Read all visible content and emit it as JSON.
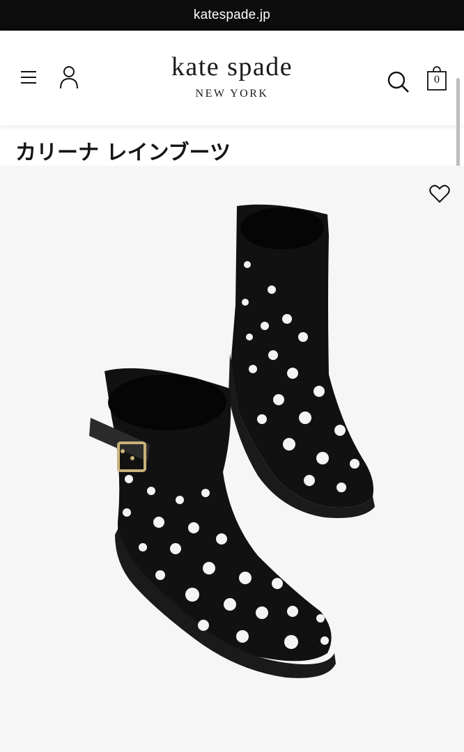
{
  "browser": {
    "url": "katespade.jp"
  },
  "header": {
    "brand_name": "kate spade",
    "brand_sub": "NEW YORK",
    "bag_count": "0",
    "icons": [
      "menu-icon",
      "account-icon",
      "search-icon",
      "bag-icon"
    ]
  },
  "product": {
    "title": "カリーナ レインブーツ",
    "wishlist_icon": "heart-icon",
    "image_bg": "#f6f6f6",
    "boot_color": "#111111",
    "dot_color": "#f4f4f4",
    "buckle_color": "#c9b27a"
  }
}
